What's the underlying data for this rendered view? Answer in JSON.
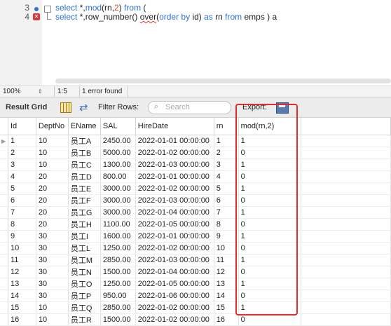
{
  "editor": {
    "lines": [
      {
        "number": "3"
      },
      {
        "number": "4"
      }
    ],
    "line3_tokens": [
      "select",
      " *,",
      "mod",
      "(rn,",
      "2",
      ") ",
      "from",
      " ("
    ],
    "line4_tokens": [
      "select",
      " *,row_number() ",
      "over",
      "(",
      "order by",
      " id) ",
      "as",
      " rn ",
      "from",
      " emps ) a"
    ]
  },
  "status_bar": {
    "zoom": "100%",
    "position": "1:5",
    "error_text": "1 error found"
  },
  "toolbar": {
    "result_tab": "Result Grid",
    "filter_label": "Filter Rows:",
    "search_placeholder": "Search",
    "export_label": "Export:"
  },
  "grid": {
    "columns": [
      "Id",
      "DeptNo",
      "EName",
      "SAL",
      "HireDate",
      "rn",
      "mod(rn,2)"
    ],
    "rows": [
      [
        "1",
        "10",
        "员工A",
        "2450.00",
        "2022-01-01 00:00:00",
        "1",
        "1"
      ],
      [
        "2",
        "10",
        "员工B",
        "5000.00",
        "2022-01-02 00:00:00",
        "2",
        "0"
      ],
      [
        "3",
        "10",
        "员工C",
        "1300.00",
        "2022-01-03 00:00:00",
        "3",
        "1"
      ],
      [
        "4",
        "20",
        "员工D",
        "800.00",
        "2022-01-01 00:00:00",
        "4",
        "0"
      ],
      [
        "5",
        "20",
        "员工E",
        "3000.00",
        "2022-01-02 00:00:00",
        "5",
        "1"
      ],
      [
        "6",
        "20",
        "员工F",
        "3000.00",
        "2022-01-03 00:00:00",
        "6",
        "0"
      ],
      [
        "7",
        "20",
        "员工G",
        "3000.00",
        "2022-01-04 00:00:00",
        "7",
        "1"
      ],
      [
        "8",
        "20",
        "员工H",
        "1100.00",
        "2022-01-05 00:00:00",
        "8",
        "0"
      ],
      [
        "9",
        "30",
        "员工I",
        "1600.00",
        "2022-01-01 00:00:00",
        "9",
        "1"
      ],
      [
        "10",
        "30",
        "员工L",
        "1250.00",
        "2022-01-02 00:00:00",
        "10",
        "0"
      ],
      [
        "11",
        "30",
        "员工M",
        "2850.00",
        "2022-01-03 00:00:00",
        "11",
        "1"
      ],
      [
        "12",
        "30",
        "员工N",
        "1500.00",
        "2022-01-04 00:00:00",
        "12",
        "0"
      ],
      [
        "13",
        "30",
        "员工O",
        "1250.00",
        "2022-01-05 00:00:00",
        "13",
        "1"
      ],
      [
        "14",
        "30",
        "员工P",
        "950.00",
        "2022-01-06 00:00:00",
        "14",
        "0"
      ],
      [
        "15",
        "10",
        "员工Q",
        "2850.00",
        "2022-01-02 00:00:00",
        "15",
        "1"
      ],
      [
        "16",
        "10",
        "员工R",
        "1500.00",
        "2022-01-02 00:00:00",
        "16",
        "0"
      ]
    ]
  },
  "colors": {
    "keyword": "#2e6fd8",
    "number": "#d8442e",
    "highlight": "#e02d2d"
  },
  "icons": {
    "line3_marker": "breakpoint-dot-icon",
    "line4_marker": "error-x-icon",
    "grid_view": "grid-view-icon",
    "refresh": "refresh-icon",
    "search": "search-icon",
    "export": "save-disk-icon"
  }
}
